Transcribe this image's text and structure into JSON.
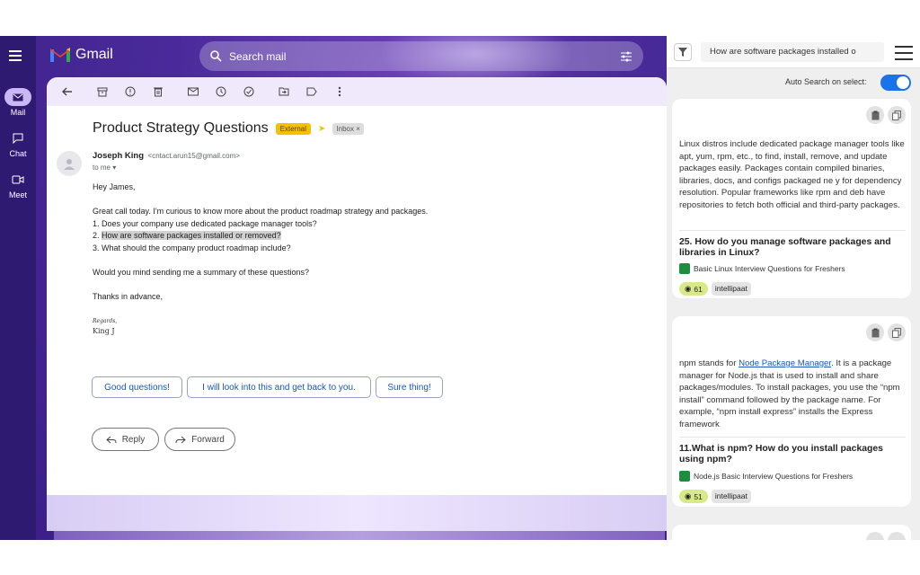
{
  "gmail": {
    "app_name": "Gmail",
    "search_placeholder": "Search mail",
    "nav": [
      {
        "label": "Mail"
      },
      {
        "label": "Chat"
      },
      {
        "label": "Meet"
      }
    ],
    "email": {
      "subject": "Product Strategy Questions",
      "badge_external": "External",
      "badge_inbox": "Inbox",
      "sender_name": "Joseph King",
      "sender_email": "<cntact.arun15@gmail.com>",
      "to": "to me",
      "greeting": "Hey James,",
      "line1": "Great call today. I'm curious to know more about the product roadmap strategy and packages.",
      "q1": "1. Does your company use dedicated package manager tools?",
      "q2_prefix": "2. ",
      "q2_highlight": "How are software packages installed or removed?",
      "q3": "3. What should the company product roadmap include?",
      "line2": "Would you mind sending me a summary of these questions?",
      "thanks": "Thanks in advance,",
      "regards": "Regards,",
      "signature": "King J"
    },
    "smart_replies": [
      "Good questions!",
      "I will look into this and get back to you.",
      "Sure thing!"
    ],
    "actions": {
      "reply": "Reply",
      "forward": "Forward"
    }
  },
  "panel": {
    "query_value": "How are software packages installed o",
    "auto_search_label": "Auto Search on select:",
    "auto_search_on": true,
    "results": [
      {
        "text": "Linux distros include dedicated package manager tools like apt, yum, rpm, etc., to find, install, remove, and update packages easily. Packages contain compiled binaries, libraries, docs, and configs packaged ne    y for dependency resolution. Popular frameworks like rpm and deb have repositories to fetch both official and third-party packages.",
        "question": "25. How do you manage software packages and libraries in Linux?",
        "source": "Basic Linux Interview Questions for Freshers",
        "views": "61",
        "tag": "intellipaat"
      },
      {
        "text_before": "npm stands for ",
        "text_link": "Node Package Manager",
        "text_after": ". It is a package manager for Node.js that is used to install and share packages/modules. To install packages, you use the “npm install” command followed by the package name. For example, “npm install express” installs the Express framework",
        "question": "11.What is npm? How do you install packages using npm?",
        "source": "Node.js Basic Interview Questions for Freshers",
        "views": "51",
        "tag": "intellipaat"
      }
    ]
  },
  "colors": {
    "accent": "#1a73e8",
    "external_badge": "#f2c200",
    "gmail_bg": "#3a1f86"
  }
}
